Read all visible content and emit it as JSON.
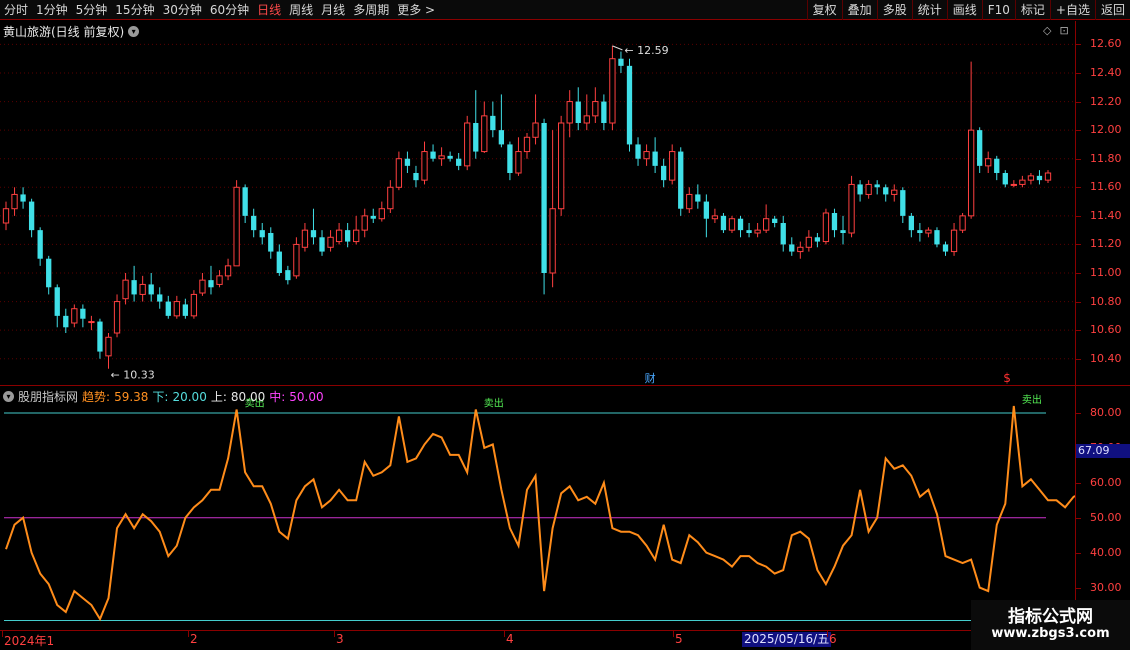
{
  "toolbar": {
    "periods": [
      "分时",
      "1分钟",
      "5分钟",
      "15分钟",
      "30分钟",
      "60分钟",
      "日线",
      "周线",
      "月线",
      "多周期",
      "更多 >"
    ],
    "active_period": "日线",
    "right_buttons": [
      "复权",
      "叠加",
      "多股",
      "统计",
      "画线",
      "F10",
      "标记",
      "+自选",
      "返回"
    ]
  },
  "stock": {
    "title": "黄山旅游(日线 前复权)",
    "high_label": "12.59",
    "low_label": "10.33",
    "marker_cai": "财",
    "marker_s": "$"
  },
  "indicator": {
    "name": "股朋指标网",
    "trend_key": "趋势:",
    "trend_val": "59.38",
    "lo_key": "下:",
    "lo_val": "20.00",
    "hi_key": "上:",
    "hi_val": "80.00",
    "mid_key": "中:",
    "mid_val": "50.00",
    "sell_label": "卖出",
    "current_value": "67.09",
    "upper": 80,
    "lower": 20,
    "mid": 50
  },
  "price_axis": [
    "12.60",
    "12.40",
    "12.20",
    "12.00",
    "11.80",
    "11.60",
    "11.40",
    "11.20",
    "11.00",
    "10.80",
    "10.60",
    "10.40"
  ],
  "ind_axis": [
    "80.00",
    "70.00",
    "60.00",
    "50.00",
    "40.00",
    "30.00"
  ],
  "date_axis": {
    "labels": [
      "2024年1",
      "2",
      "3",
      "4",
      "5",
      "6"
    ],
    "cursor": "2025/05/16/五"
  },
  "watermark": {
    "line1": "指标公式网",
    "line2": "www.zbgs3.com"
  },
  "colors": {
    "up": "#ff4040",
    "down": "#40e0e8",
    "trend_line": "#ff8c1a",
    "mid_line": "#cc33cc",
    "band_line": "#44cccc",
    "axis": "#8a0000"
  },
  "chart_data": {
    "type": "candlestick",
    "price_ylim": [
      10.3,
      12.68
    ],
    "candles": [
      [
        11.35,
        11.45,
        11.3,
        11.5
      ],
      [
        11.45,
        11.55,
        11.4,
        11.6
      ],
      [
        11.55,
        11.5,
        11.45,
        11.6
      ],
      [
        11.5,
        11.3,
        11.25,
        11.52
      ],
      [
        11.3,
        11.1,
        11.05,
        11.32
      ],
      [
        11.1,
        10.9,
        10.85,
        11.12
      ],
      [
        10.9,
        10.7,
        10.62,
        10.92
      ],
      [
        10.7,
        10.62,
        10.58,
        10.75
      ],
      [
        10.65,
        10.75,
        10.62,
        10.78
      ],
      [
        10.75,
        10.68,
        10.62,
        10.78
      ],
      [
        10.66,
        10.66,
        10.6,
        10.7
      ],
      [
        10.66,
        10.45,
        10.4,
        10.68
      ],
      [
        10.42,
        10.55,
        10.33,
        10.58
      ],
      [
        10.58,
        10.8,
        10.55,
        10.85
      ],
      [
        10.82,
        10.95,
        10.78,
        11.0
      ],
      [
        10.95,
        10.85,
        10.8,
        11.05
      ],
      [
        10.85,
        10.92,
        10.8,
        10.98
      ],
      [
        10.92,
        10.85,
        10.8,
        11.0
      ],
      [
        10.85,
        10.8,
        10.75,
        10.9
      ],
      [
        10.8,
        10.7,
        10.68,
        10.84
      ],
      [
        10.7,
        10.8,
        10.68,
        10.84
      ],
      [
        10.78,
        10.7,
        10.68,
        10.82
      ],
      [
        10.7,
        10.85,
        10.68,
        10.88
      ],
      [
        10.86,
        10.95,
        10.84,
        11.0
      ],
      [
        10.95,
        10.9,
        10.85,
        11.05
      ],
      [
        10.92,
        10.98,
        10.9,
        11.02
      ],
      [
        10.98,
        11.05,
        10.95,
        11.1
      ],
      [
        11.05,
        11.6,
        11.05,
        11.65
      ],
      [
        11.6,
        11.4,
        11.35,
        11.62
      ],
      [
        11.4,
        11.3,
        11.25,
        11.45
      ],
      [
        11.3,
        11.25,
        11.2,
        11.35
      ],
      [
        11.28,
        11.15,
        11.1,
        11.32
      ],
      [
        11.15,
        11.0,
        10.98,
        11.2
      ],
      [
        11.02,
        10.95,
        10.92,
        11.05
      ],
      [
        10.98,
        11.2,
        10.96,
        11.25
      ],
      [
        11.18,
        11.3,
        11.15,
        11.35
      ],
      [
        11.3,
        11.25,
        11.2,
        11.45
      ],
      [
        11.25,
        11.15,
        11.12,
        11.3
      ],
      [
        11.18,
        11.25,
        11.15,
        11.3
      ],
      [
        11.22,
        11.3,
        11.2,
        11.35
      ],
      [
        11.3,
        11.22,
        11.18,
        11.35
      ],
      [
        11.22,
        11.3,
        11.2,
        11.4
      ],
      [
        11.3,
        11.4,
        11.25,
        11.45
      ],
      [
        11.4,
        11.38,
        11.35,
        11.45
      ],
      [
        11.38,
        11.45,
        11.36,
        11.5
      ],
      [
        11.45,
        11.6,
        11.42,
        11.65
      ],
      [
        11.6,
        11.8,
        11.58,
        11.85
      ],
      [
        11.8,
        11.75,
        11.7,
        11.85
      ],
      [
        11.7,
        11.65,
        11.6,
        11.75
      ],
      [
        11.65,
        11.85,
        11.62,
        11.92
      ],
      [
        11.85,
        11.8,
        11.78,
        11.9
      ],
      [
        11.8,
        11.82,
        11.75,
        11.88
      ],
      [
        11.82,
        11.8,
        11.78,
        11.85
      ],
      [
        11.8,
        11.75,
        11.72,
        11.84
      ],
      [
        11.75,
        12.05,
        11.72,
        12.1
      ],
      [
        12.05,
        11.85,
        11.8,
        12.28
      ],
      [
        11.85,
        12.1,
        11.84,
        12.2
      ],
      [
        12.1,
        12.0,
        11.95,
        12.2
      ],
      [
        12.0,
        11.9,
        11.88,
        12.25
      ],
      [
        11.9,
        11.7,
        11.65,
        11.92
      ],
      [
        11.7,
        11.85,
        11.68,
        11.95
      ],
      [
        11.85,
        11.95,
        11.8,
        11.98
      ],
      [
        11.95,
        12.05,
        11.9,
        12.25
      ],
      [
        12.05,
        11.0,
        10.85,
        12.08
      ],
      [
        11.0,
        11.45,
        10.9,
        12.0
      ],
      [
        11.45,
        12.05,
        11.4,
        12.1
      ],
      [
        12.05,
        12.2,
        11.95,
        12.28
      ],
      [
        12.2,
        12.05,
        12.0,
        12.3
      ],
      [
        12.05,
        12.1,
        12.0,
        12.25
      ],
      [
        12.1,
        12.2,
        12.05,
        12.3
      ],
      [
        12.2,
        12.05,
        12.0,
        12.25
      ],
      [
        12.05,
        12.5,
        12.0,
        12.59
      ],
      [
        12.5,
        12.45,
        12.4,
        12.55
      ],
      [
        12.45,
        11.9,
        11.85,
        12.5
      ],
      [
        11.9,
        11.8,
        11.75,
        11.95
      ],
      [
        11.8,
        11.85,
        11.75,
        11.9
      ],
      [
        11.85,
        11.75,
        11.7,
        11.95
      ],
      [
        11.75,
        11.65,
        11.6,
        11.8
      ],
      [
        11.65,
        11.85,
        11.62,
        11.9
      ],
      [
        11.85,
        11.45,
        11.4,
        11.88
      ],
      [
        11.45,
        11.55,
        11.42,
        11.6
      ],
      [
        11.55,
        11.5,
        11.45,
        11.62
      ],
      [
        11.5,
        11.38,
        11.25,
        11.55
      ],
      [
        11.38,
        11.4,
        11.35,
        11.45
      ],
      [
        11.4,
        11.3,
        11.28,
        11.42
      ],
      [
        11.3,
        11.38,
        11.28,
        11.4
      ],
      [
        11.38,
        11.3,
        11.25,
        11.4
      ],
      [
        11.3,
        11.28,
        11.25,
        11.35
      ],
      [
        11.28,
        11.3,
        11.25,
        11.35
      ],
      [
        11.3,
        11.38,
        11.28,
        11.48
      ],
      [
        11.38,
        11.35,
        11.32,
        11.4
      ],
      [
        11.35,
        11.2,
        11.15,
        11.4
      ],
      [
        11.2,
        11.15,
        11.12,
        11.25
      ],
      [
        11.15,
        11.18,
        11.1,
        11.22
      ],
      [
        11.18,
        11.25,
        11.15,
        11.3
      ],
      [
        11.25,
        11.22,
        11.18,
        11.28
      ],
      [
        11.22,
        11.42,
        11.2,
        11.45
      ],
      [
        11.42,
        11.3,
        11.25,
        11.45
      ],
      [
        11.3,
        11.28,
        11.2,
        11.4
      ],
      [
        11.28,
        11.62,
        11.25,
        11.68
      ],
      [
        11.62,
        11.55,
        11.5,
        11.65
      ],
      [
        11.55,
        11.62,
        11.52,
        11.65
      ],
      [
        11.62,
        11.6,
        11.55,
        11.65
      ],
      [
        11.6,
        11.55,
        11.5,
        11.62
      ],
      [
        11.55,
        11.58,
        11.5,
        11.62
      ],
      [
        11.58,
        11.4,
        11.35,
        11.6
      ],
      [
        11.4,
        11.3,
        11.25,
        11.42
      ],
      [
        11.3,
        11.28,
        11.22,
        11.35
      ],
      [
        11.28,
        11.3,
        11.25,
        11.32
      ],
      [
        11.3,
        11.2,
        11.18,
        11.32
      ],
      [
        11.2,
        11.15,
        11.12,
        11.22
      ],
      [
        11.15,
        11.3,
        11.12,
        11.35
      ],
      [
        11.3,
        11.4,
        11.28,
        11.42
      ],
      [
        11.4,
        12.0,
        11.38,
        12.48
      ],
      [
        12.0,
        11.75,
        11.7,
        12.02
      ],
      [
        11.75,
        11.8,
        11.7,
        11.85
      ],
      [
        11.8,
        11.7,
        11.65,
        11.82
      ],
      [
        11.7,
        11.62,
        11.6,
        11.72
      ],
      [
        11.62,
        11.62,
        11.6,
        11.65
      ],
      [
        11.62,
        11.65,
        11.6,
        11.68
      ],
      [
        11.65,
        11.68,
        11.62,
        11.7
      ],
      [
        11.68,
        11.65,
        11.62,
        11.72
      ],
      [
        11.65,
        11.7,
        11.63,
        11.72
      ]
    ],
    "trend": [
      41,
      48,
      50,
      40,
      34,
      31,
      25,
      23,
      29,
      27,
      25,
      21,
      27,
      47,
      51,
      47,
      51,
      49,
      46,
      39,
      42,
      50,
      53,
      55,
      58,
      58,
      67,
      81,
      63,
      59,
      59,
      54,
      46,
      44,
      55,
      59,
      61,
      53,
      55,
      58,
      55,
      55,
      66,
      62,
      63,
      65,
      79,
      66,
      67,
      71,
      74,
      73,
      68,
      68,
      63,
      81,
      70,
      71,
      58,
      47,
      42,
      58,
      62,
      29,
      47,
      57,
      59,
      55,
      56,
      54,
      60,
      47,
      46,
      46,
      45,
      42,
      38,
      48,
      38,
      37,
      45,
      43,
      40,
      39,
      38,
      36,
      39,
      39,
      37,
      36,
      34,
      35,
      45,
      46,
      44,
      35,
      31,
      36,
      42,
      45,
      58,
      46,
      50,
      67,
      64,
      65,
      62,
      56,
      58,
      51,
      39,
      38,
      37,
      38,
      30,
      29,
      48,
      54,
      82,
      59,
      61,
      58,
      55,
      55,
      53,
      56,
      57,
      59
    ],
    "sell_points": [
      27,
      55,
      118
    ],
    "ind_ylim": [
      19,
      86
    ]
  }
}
